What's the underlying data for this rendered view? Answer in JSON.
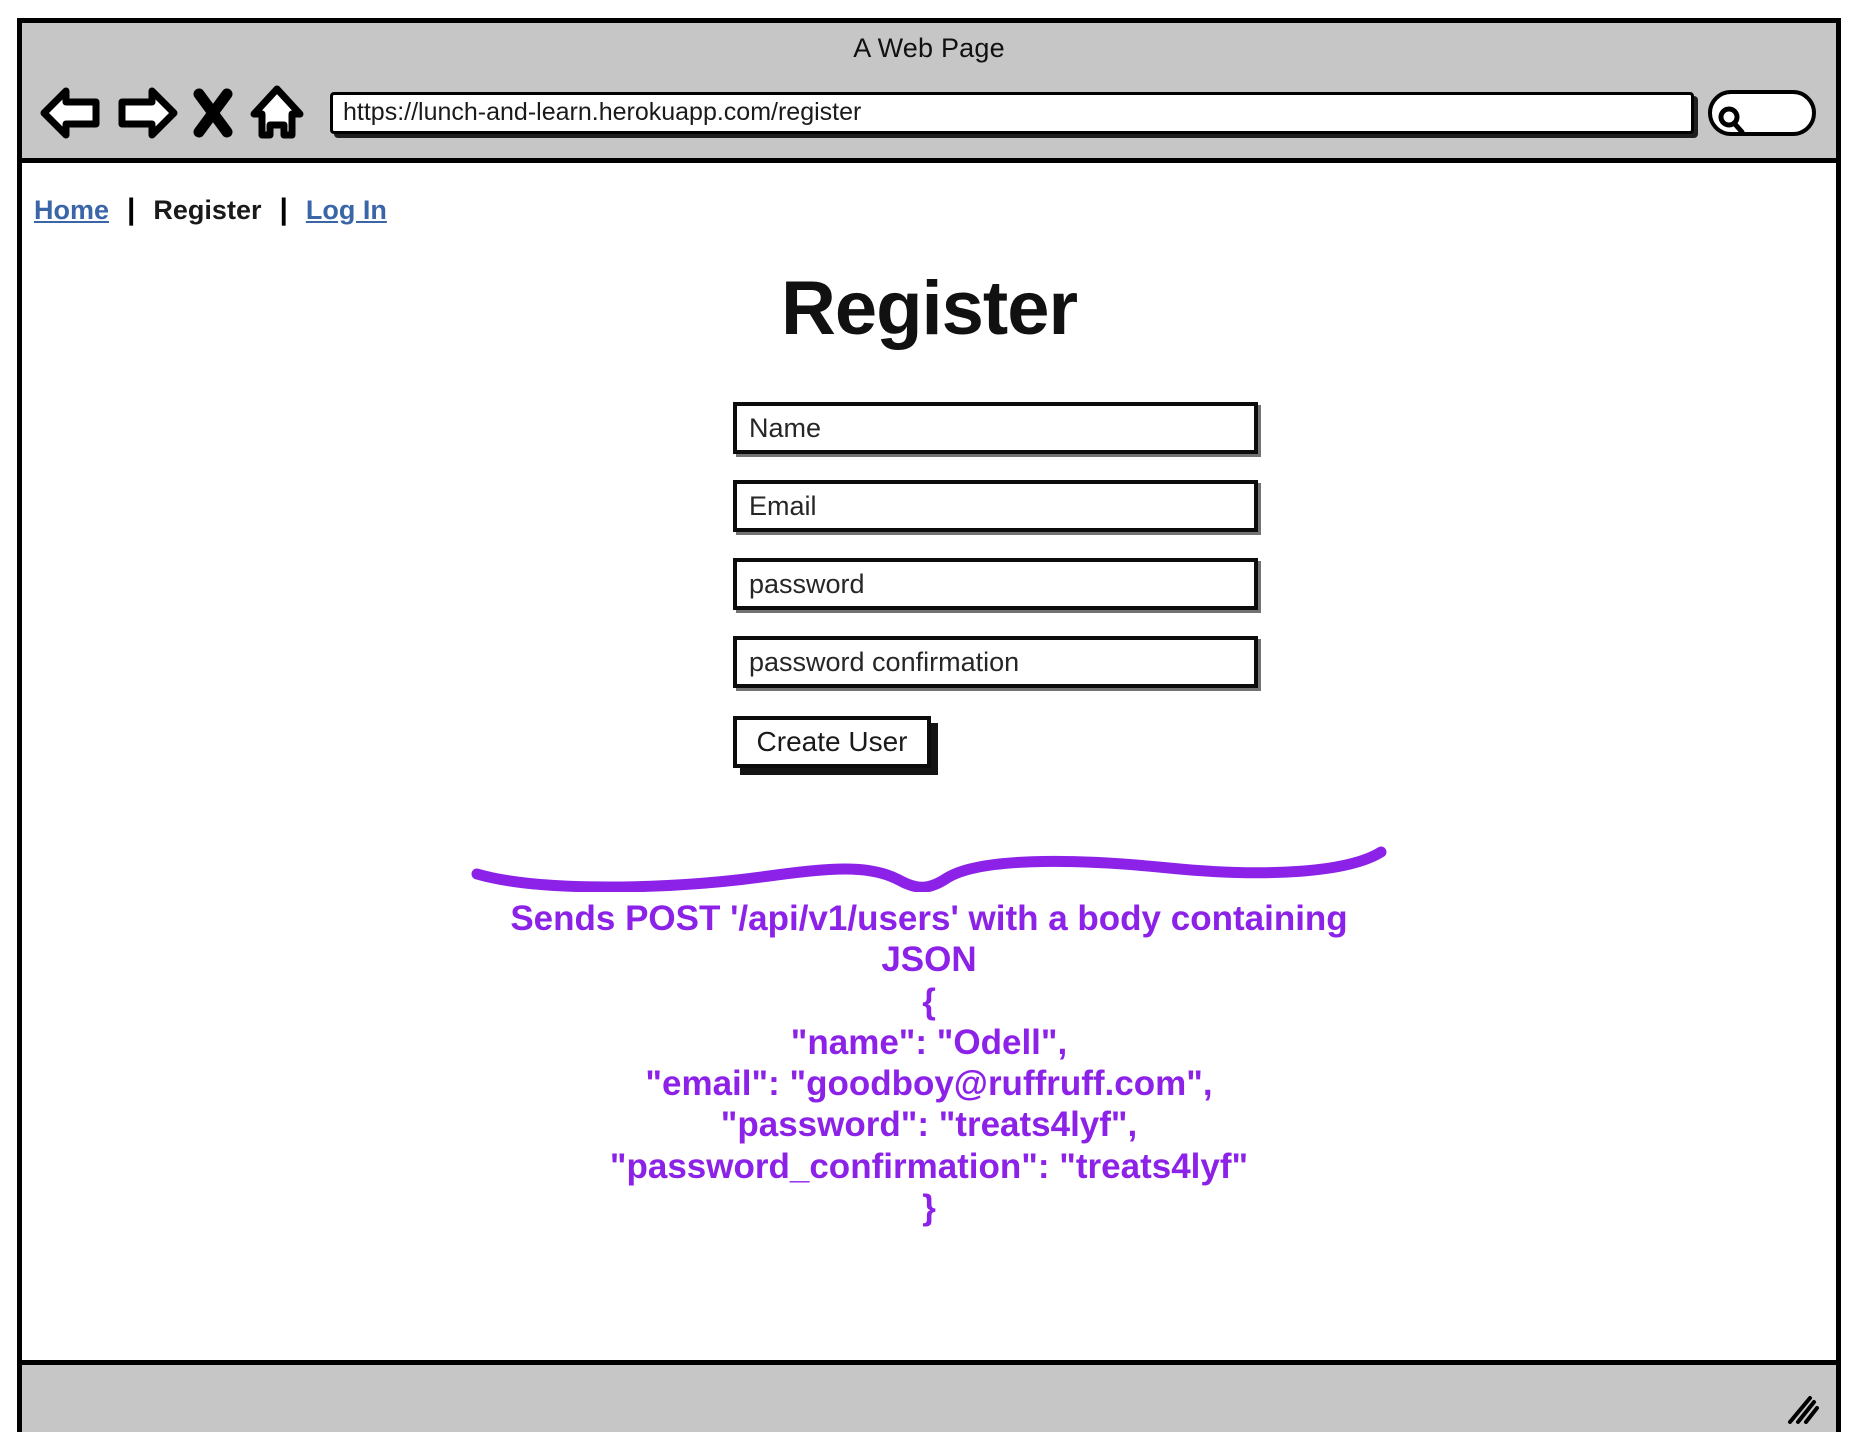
{
  "browser": {
    "window_title": "A Web Page",
    "url": "https://lunch-and-learn.herokuapp.com/register",
    "toolbar_icons": [
      "back-arrow-icon",
      "forward-arrow-icon",
      "close-x-icon",
      "home-icon"
    ],
    "search_placeholder": "",
    "search_icon": "magnifier-icon",
    "resize_grip_icon": "resize-grip-icon"
  },
  "nav": {
    "items": [
      {
        "label": "Home",
        "type": "link"
      },
      {
        "label": "Register",
        "type": "current"
      },
      {
        "label": "Log In",
        "type": "link"
      }
    ],
    "separator": "|"
  },
  "page": {
    "heading": "Register"
  },
  "form": {
    "fields": [
      {
        "name": "name-field",
        "placeholder": "Name"
      },
      {
        "name": "email-field",
        "placeholder": "Email"
      },
      {
        "name": "password-field",
        "placeholder": "password"
      },
      {
        "name": "password-confirmation-field",
        "placeholder": "password confirmation"
      }
    ],
    "submit_label": "Create User"
  },
  "annotation": {
    "color": "#8c22e8",
    "lines": [
      "Sends POST '/api/v1/users' with a body containing",
      "JSON",
      "{",
      "\"name\": \"Odell\",",
      "\"email\": \"goodboy@ruffruff.com\",",
      "\"password\": \"treats4lyf\",",
      "\"password_confirmation\": \"treats4lyf\"",
      "}"
    ]
  },
  "colors": {
    "chrome_gray": "#c6c6c6",
    "link_blue": "#3a66a8",
    "ink_black": "#000000",
    "annotation_purple": "#8c22e8"
  }
}
